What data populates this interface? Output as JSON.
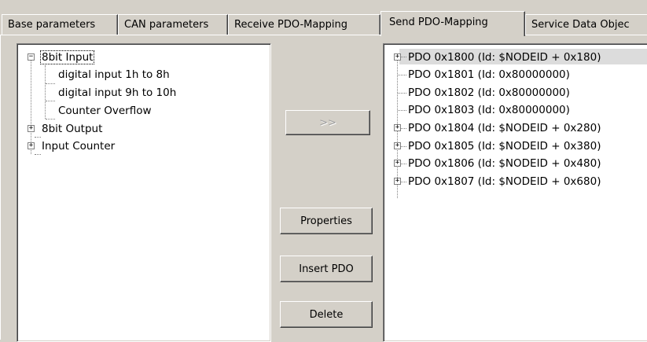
{
  "tabs": [
    {
      "label": "Base parameters"
    },
    {
      "label": "CAN parameters"
    },
    {
      "label": "Receive PDO-Mapping"
    },
    {
      "label": "Send PDO-Mapping",
      "active": true
    },
    {
      "label": "Service Data Objec"
    }
  ],
  "left_tree": {
    "items": [
      {
        "label": "8bit Input",
        "expanded": true,
        "selected": true
      },
      {
        "label": "digital input 1h to 8h"
      },
      {
        "label": "digital input 9h to 10h"
      },
      {
        "label": "Counter Overflow"
      },
      {
        "label": "8bit Output",
        "expanded": false
      },
      {
        "label": "Input Counter",
        "expanded": false
      }
    ]
  },
  "buttons": {
    "move": ">>",
    "properties": "Properties",
    "insert_pdo": "Insert PDO",
    "delete": "Delete"
  },
  "right_tree": {
    "items": [
      {
        "label": "PDO 0x1800 (Id: $NODEID + 0x180)",
        "expandable": true,
        "highlighted": true
      },
      {
        "label": "PDO 0x1801 (Id: 0x80000000)",
        "expandable": false
      },
      {
        "label": "PDO 0x1802 (Id: 0x80000000)",
        "expandable": false
      },
      {
        "label": "PDO 0x1803 (Id: 0x80000000)",
        "expandable": false
      },
      {
        "label": "PDO 0x1804 (Id: $NODEID + 0x280)",
        "expandable": true
      },
      {
        "label": "PDO 0x1805 (Id: $NODEID + 0x380)",
        "expandable": true
      },
      {
        "label": "PDO 0x1806 (Id: $NODEID + 0x480)",
        "expandable": true
      },
      {
        "label": "PDO 0x1807 (Id: $NODEID + 0x680)",
        "expandable": true
      }
    ]
  },
  "icons": {
    "expand": "+",
    "collapse": "−"
  }
}
